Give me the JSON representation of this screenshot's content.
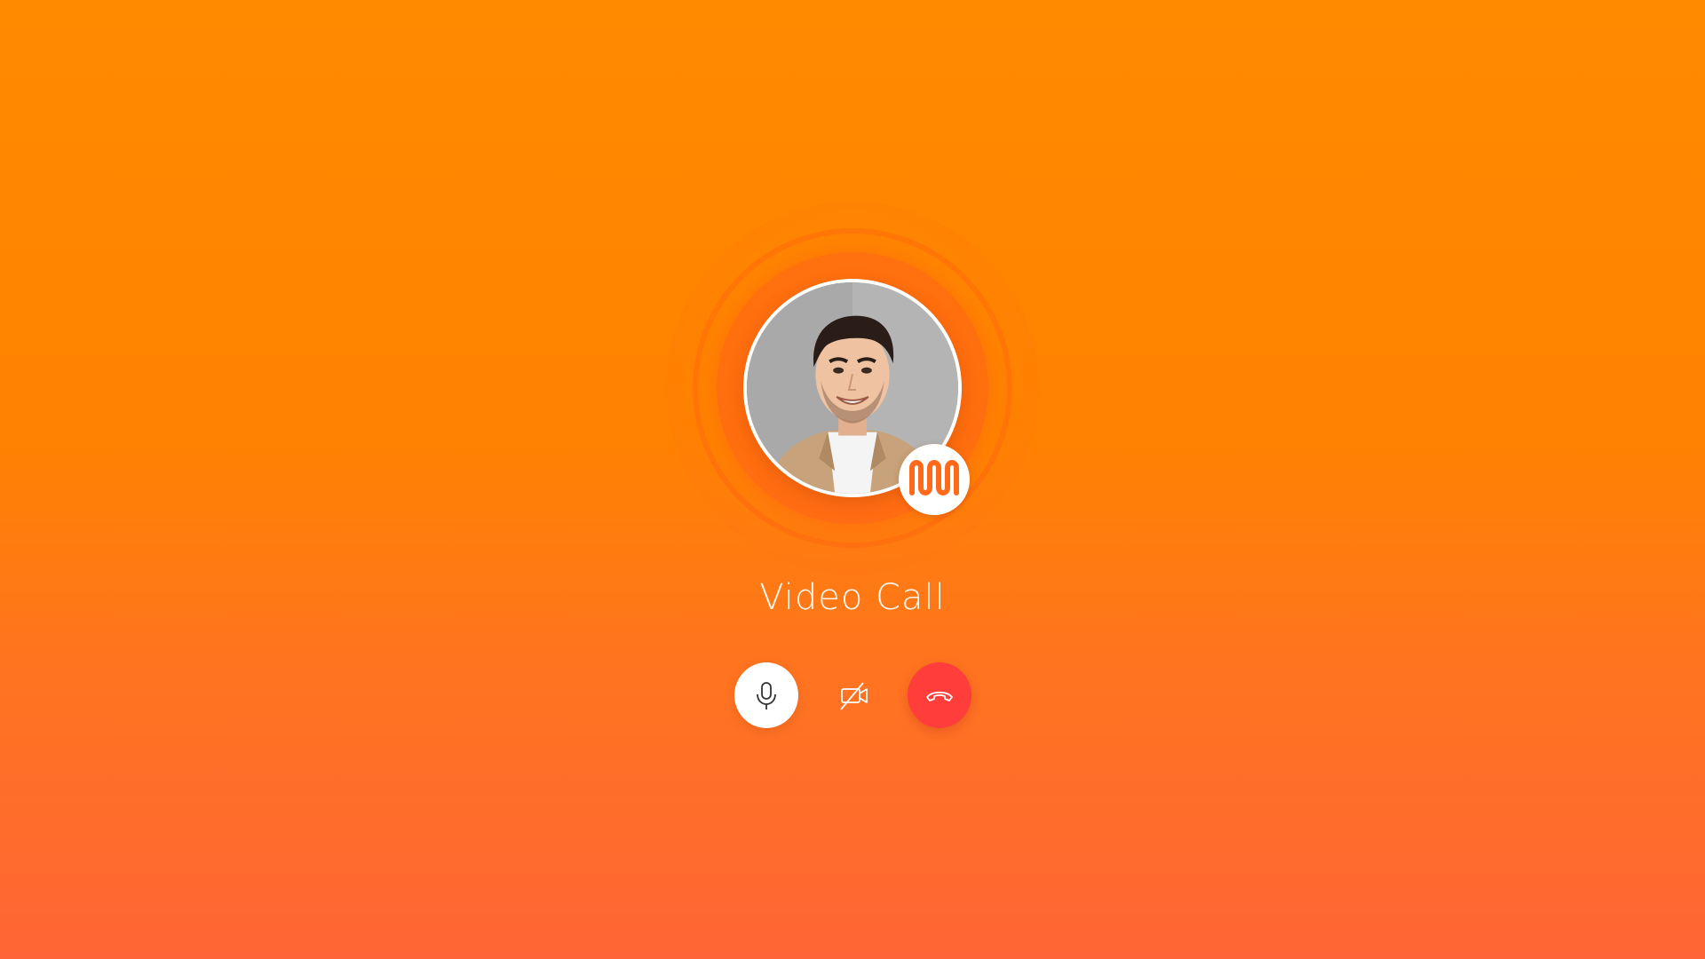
{
  "call": {
    "title": "Video Call"
  },
  "controls": {
    "mic_icon": "microphone-icon",
    "video_icon": "video-off-icon",
    "end_icon": "phone-hangup-icon"
  },
  "colors": {
    "background_top": "#ff8a00",
    "background_bottom": "#ff6535",
    "end_call": "#ff3d3a",
    "mic_button": "#ffffff",
    "brand": "#ff6a1a"
  }
}
